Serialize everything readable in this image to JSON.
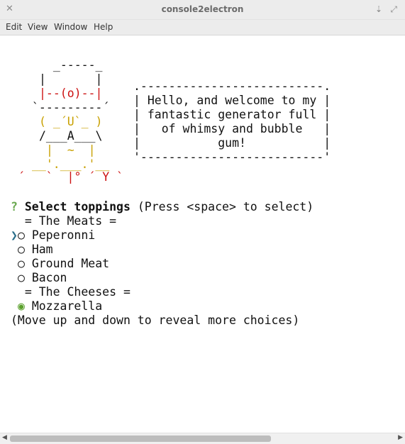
{
  "window": {
    "title": "console2electron",
    "close_glyph": "✕",
    "minimize_glyph": "⇣",
    "maximize_glyph": "⤢"
  },
  "menu": [
    "Edit",
    "View",
    "Window",
    "Help"
  ],
  "ascii_art": {
    "hat_top": " _-----_",
    "hat_mid1": "|       |",
    "hat_mid2": "|--(o)--|",
    "hat_brim": "`---------´",
    "face": "( _´U`_ )",
    "body1": "/___A___\\",
    "body2": "|  ~  |",
    "legs1": "__'.___.'__",
    "legs2": "´   `  |° ´ Y `",
    "speech_bubble": ".--------------------------.\n| Hello, and welcome to my |\n| fantastic generator full |\n|   of whimsy and bubble   |\n|           gum!           |\n'--------------------------'"
  },
  "prompt": {
    "qmark": "?",
    "title": "Select toppings",
    "hint": "(Press <space> to select)",
    "groups": [
      {
        "separator": "= The Meats =",
        "options": [
          {
            "label": "Peperonni",
            "selected": false,
            "cursor": true
          },
          {
            "label": "Ham",
            "selected": false,
            "cursor": false
          },
          {
            "label": "Ground Meat",
            "selected": false,
            "cursor": false
          },
          {
            "label": "Bacon",
            "selected": false,
            "cursor": false
          }
        ]
      },
      {
        "separator": "= The Cheeses =",
        "options": [
          {
            "label": "Mozzarella",
            "selected": true,
            "cursor": false
          }
        ]
      }
    ],
    "footer": "(Move up and down to reveal more choices)",
    "cursor_glyph": "❯",
    "radio_empty": "○",
    "radio_filled": "◉"
  },
  "colors": {
    "qmark": "#6aa84f",
    "selected": "#5aa02c",
    "yellow": "#c8a000",
    "red": "#cc1111"
  }
}
